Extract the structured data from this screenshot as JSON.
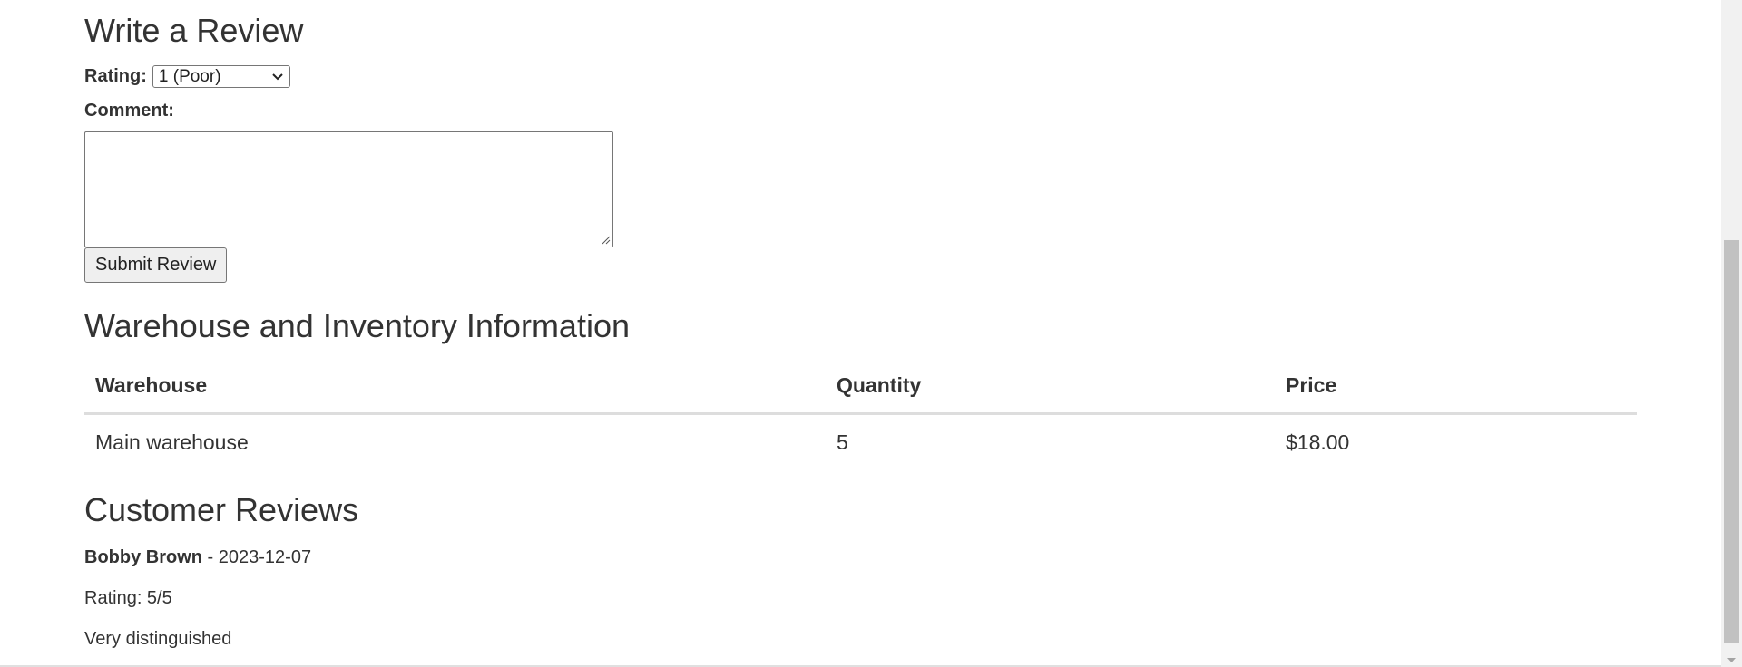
{
  "review_form": {
    "heading": "Write a Review",
    "rating_label": "Rating:",
    "rating_selected": "1 (Poor)",
    "comment_label": "Comment:",
    "comment_value": "",
    "submit_label": "Submit Review"
  },
  "inventory": {
    "heading": "Warehouse and Inventory Information",
    "columns": [
      "Warehouse",
      "Quantity",
      "Price"
    ],
    "rows": [
      {
        "warehouse": "Main warehouse",
        "quantity": "5",
        "price": "$18.00"
      }
    ]
  },
  "reviews": {
    "heading": "Customer Reviews",
    "items": [
      {
        "author": "Bobby Brown",
        "separator": " - ",
        "date": "2023-12-07",
        "rating": "Rating: 5/5",
        "text": "Very distinguished"
      }
    ]
  },
  "icons": {
    "select_chevron": "chevron-down-icon",
    "textarea_grip": "resize-grip-icon",
    "scroll_down": "scroll-down-arrow-icon"
  }
}
